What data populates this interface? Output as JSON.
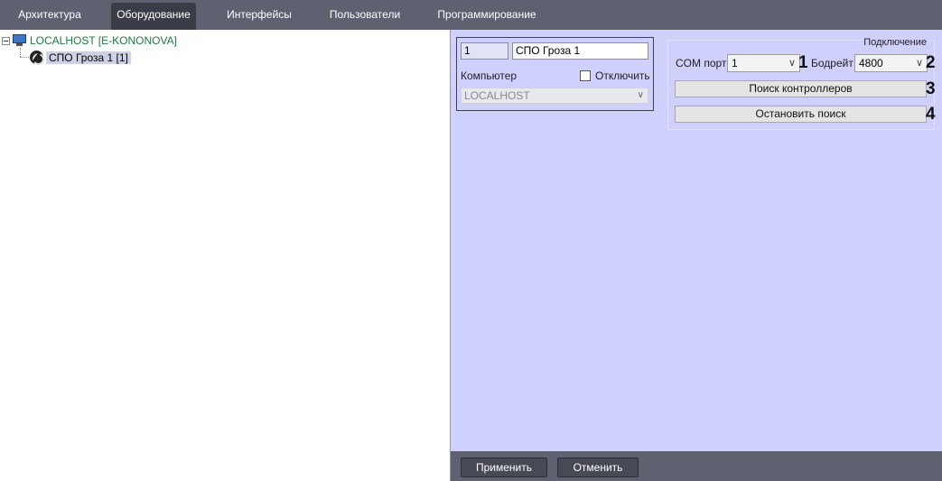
{
  "tabs": [
    {
      "label": "Архитектура",
      "active": false
    },
    {
      "label": "Оборудование",
      "active": true
    },
    {
      "label": "Интерфейсы",
      "active": false
    },
    {
      "label": "Пользователи",
      "active": false
    },
    {
      "label": "Программирование",
      "active": false
    }
  ],
  "tree": {
    "root": {
      "label": "LOCALHOST [E-KONONOVA]",
      "icon": "monitor-icon"
    },
    "child": {
      "label": "СПО Гроза 1 [1]",
      "icon": "device-icon",
      "selected": true
    }
  },
  "device": {
    "number": "1",
    "name": "СПО Гроза 1",
    "computer_label": "Компьютер",
    "disable_label": "Отключить",
    "disable_checked": false,
    "computer_value": "LOCALHOST"
  },
  "connection": {
    "title": "Подключение",
    "com_port_label": "COM порт",
    "com_port_value": "1",
    "baud_label": "Бодрейт",
    "baud_value": "4800",
    "search_button": "Поиск контроллеров",
    "stop_button": "Остановить поиск"
  },
  "callouts": [
    "1",
    "2",
    "3",
    "4"
  ],
  "footer": {
    "apply": "Применить",
    "cancel": "Отменить"
  },
  "colors": {
    "tabbar": "#5d6170",
    "active_tab": "#3a3d47",
    "panel": "#cfd0fb",
    "root_label": "#1f7a3a",
    "selected_item": "#cfd2e6"
  }
}
